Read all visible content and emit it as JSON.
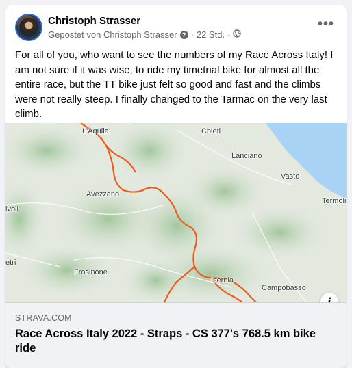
{
  "post": {
    "author": "Christoph Strasser",
    "posted_by": "Gepostet von Christoph Strasser",
    "time": "22 Std.",
    "separator": "·",
    "more_icon": "more-horizontal-icon",
    "text": "For all of you, who want to see the numbers of my Race Across Italy! I am not sure if it was wise, to ride my timetrial bike for almost all the entire race, but the TT bike just felt so good and fast and the climbs were not really steep. I finally changed to the Tarmac on the very last climb."
  },
  "map": {
    "route_color": "#f05a1e",
    "water_color": "#a9d3f5",
    "cities": {
      "laquila": "L'Aquila",
      "chieti": "Chieti",
      "lanciano": "Lanciano",
      "vasto": "Vasto",
      "termoli": "Termoli",
      "avezzano": "Avezzano",
      "tivoli": "ivoli",
      "rieti": "etri",
      "frosinone": "Frosinone",
      "isernia": "Isernia",
      "campobasso": "Campobasso"
    },
    "info_label": "i"
  },
  "link": {
    "domain": "STRAVA.COM",
    "title": "Race Across Italy 2022 - Straps - CS 377's 768.5 km bike ride"
  }
}
